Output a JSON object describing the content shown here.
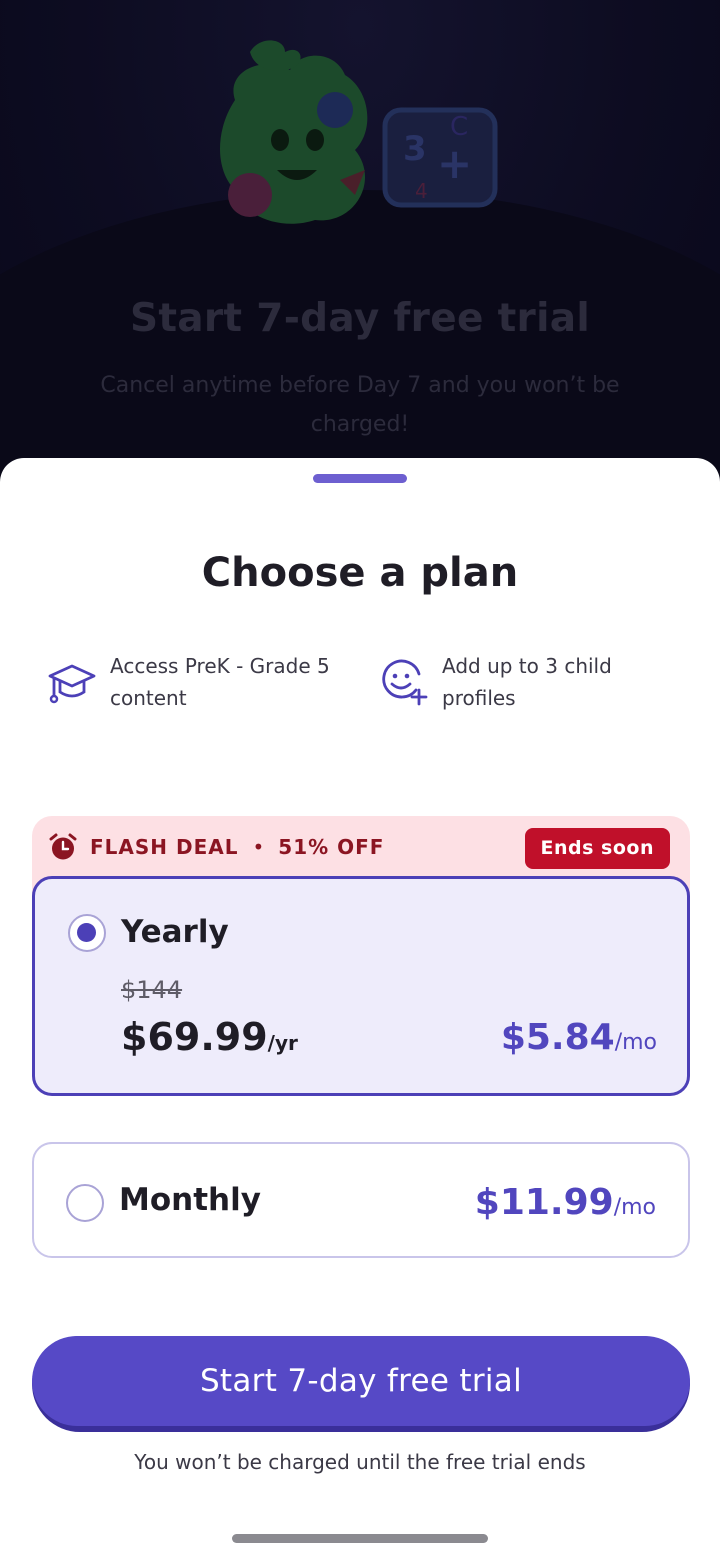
{
  "background": {
    "title": "Start 7-day free trial",
    "subtitle": "Cancel anytime before Day 7 and you won’t be charged!"
  },
  "sheet": {
    "title": "Choose a plan",
    "features": [
      {
        "icon": "graduation-cap-icon",
        "text": "Access PreK - Grade 5 content"
      },
      {
        "icon": "add-profile-icon",
        "text": "Add up to 3 child profiles"
      }
    ],
    "deal": {
      "label": "FLASH DEAL",
      "separator": "•",
      "discount": "51% OFF",
      "badge": "Ends soon"
    },
    "plans": {
      "yearly": {
        "name": "Yearly",
        "selected": true,
        "original_price": "$144",
        "price": "$69.99",
        "price_unit": "/yr",
        "monthly_equivalent": "$5.84",
        "monthly_unit": "/mo"
      },
      "monthly": {
        "name": "Monthly",
        "selected": false,
        "price": "$11.99",
        "price_unit": "/mo"
      }
    },
    "cta_label": "Start 7-day free trial",
    "note": "You won’t be charged until the free trial ends"
  },
  "colors": {
    "accent": "#5649c6",
    "deal_background": "#fde0e4",
    "badge_red": "#c0102a"
  }
}
